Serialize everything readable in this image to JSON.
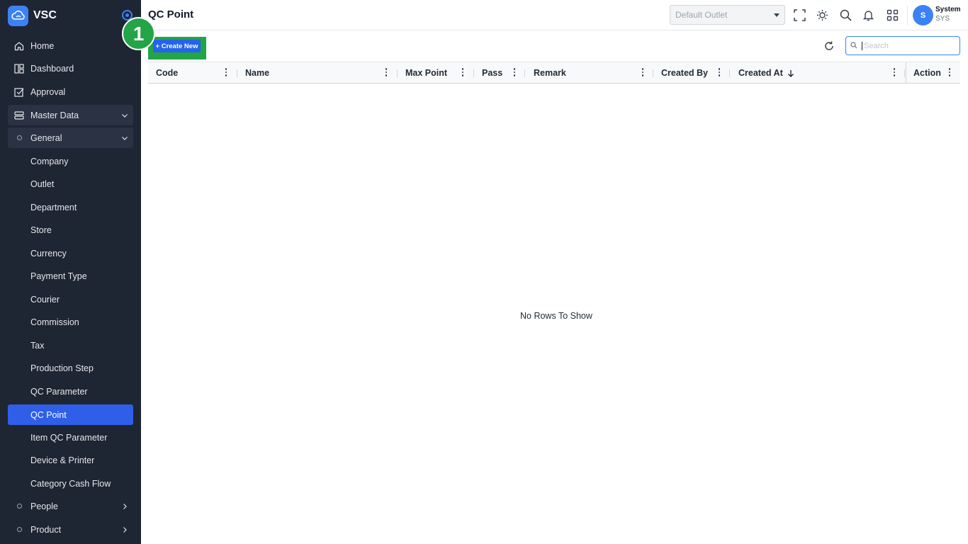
{
  "brand": {
    "name": "VSC"
  },
  "sidebar": {
    "items": [
      {
        "label": "Home",
        "icon": "home-icon"
      },
      {
        "label": "Dashboard",
        "icon": "dashboard-icon"
      },
      {
        "label": "Approval",
        "icon": "approval-icon"
      },
      {
        "label": "Master Data",
        "icon": "database-icon",
        "expanded": true
      },
      {
        "label": "General",
        "expanded": true
      },
      {
        "label": "Company"
      },
      {
        "label": "Outlet"
      },
      {
        "label": "Department"
      },
      {
        "label": "Store"
      },
      {
        "label": "Currency"
      },
      {
        "label": "Payment Type"
      },
      {
        "label": "Courier"
      },
      {
        "label": "Commission"
      },
      {
        "label": "Tax"
      },
      {
        "label": "Production Step"
      },
      {
        "label": "QC Parameter"
      },
      {
        "label": "QC Point",
        "active": true
      },
      {
        "label": "Item QC Parameter"
      },
      {
        "label": "Device & Printer"
      },
      {
        "label": "Category Cash Flow"
      },
      {
        "label": "People",
        "collapsed": true
      },
      {
        "label": "Product",
        "collapsed": true
      }
    ]
  },
  "header": {
    "title": "QC Point",
    "outlet_placeholder": "Default Outlet",
    "icons": [
      "fullscreen-icon",
      "theme-icon",
      "search-icon",
      "bell-icon",
      "apps-icon"
    ],
    "user": {
      "initial": "S",
      "name": "System",
      "code": "SYS"
    }
  },
  "toolbar": {
    "create_label": "+ Create New",
    "step_badge": "1",
    "search_placeholder": "Search"
  },
  "grid": {
    "columns": [
      "Code",
      "Name",
      "Max Point",
      "Pass",
      "Remark",
      "Created By",
      "Created At",
      "Action"
    ],
    "sorted_column": "Created At",
    "sort_direction": "desc",
    "empty_message": "No Rows To Show"
  },
  "colors": {
    "sidebar_bg": "#1e2533",
    "accent": "#2f5fe8",
    "highlight": "#22a447"
  }
}
